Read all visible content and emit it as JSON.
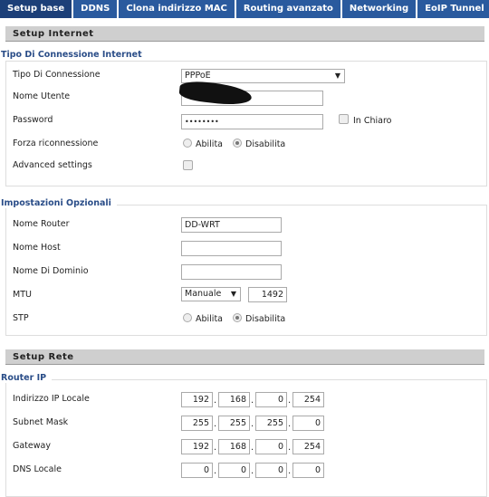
{
  "tabs": [
    "Setup base",
    "DDNS",
    "Clona indirizzo MAC",
    "Routing avanzato",
    "Networking",
    "EoIP Tunnel"
  ],
  "active_tab": "Setup base",
  "setup_internet": {
    "title": "Setup Internet",
    "legend": "Tipo Di Connessione Internet",
    "conn_type_label": "Tipo Di Connessione",
    "conn_type_value": "PPPoE",
    "username_label": "Nome Utente",
    "username_value": "",
    "password_label": "Password",
    "password_value": "••••••••",
    "show_label": "In Chiaro",
    "reconnect_label": "Forza riconnessione",
    "enable": "Abilita",
    "disable": "Disabilita",
    "reconnect_selected": "Disabilita",
    "advanced_label": "Advanced settings",
    "advanced_checked": false
  },
  "optional": {
    "legend": "Impostazioni Opzionali",
    "router_name_label": "Nome Router",
    "router_name_value": "DD-WRT",
    "host_label": "Nome Host",
    "host_value": "",
    "domain_label": "Nome Di Dominio",
    "domain_value": "",
    "mtu_label": "MTU",
    "mtu_mode": "Manuale",
    "mtu_value": "1492",
    "stp_label": "STP",
    "enable": "Abilita",
    "disable": "Disabilita",
    "stp_selected": "Disabilita"
  },
  "setup_rete": {
    "title": "Setup Rete",
    "legend": "Router IP",
    "rows": [
      {
        "label": "Indirizzo IP Locale",
        "octets": [
          "192",
          "168",
          "0",
          "254"
        ]
      },
      {
        "label": "Subnet Mask",
        "octets": [
          "255",
          "255",
          "255",
          "0"
        ]
      },
      {
        "label": "Gateway",
        "octets": [
          "192",
          "168",
          "0",
          "254"
        ]
      },
      {
        "label": "DNS Locale",
        "octets": [
          "0",
          "0",
          "0",
          "0"
        ]
      }
    ]
  }
}
